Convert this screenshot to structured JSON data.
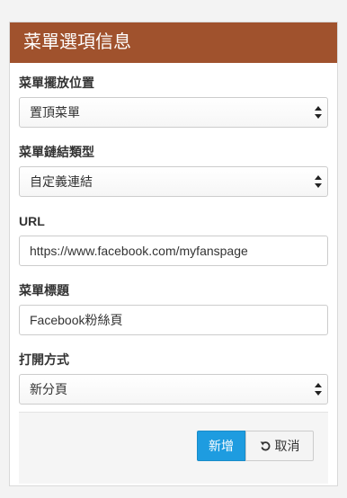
{
  "panel": {
    "title": "菜單選項信息"
  },
  "fields": {
    "position": {
      "label": "菜單擺放位置",
      "value": "置頂菜單"
    },
    "link_type": {
      "label": "菜單鏈結類型",
      "value": "自定義連結"
    },
    "url": {
      "label": "URL",
      "value": "https://www.facebook.com/myfanspage"
    },
    "menu_title": {
      "label": "菜單標題",
      "value": "Facebook粉絲頁"
    },
    "open_mode": {
      "label": "打開方式",
      "value": "新分頁"
    }
  },
  "buttons": {
    "add_label": "新增",
    "cancel_label": "取消",
    "cancel_icon": "undo-icon"
  },
  "colors": {
    "header_bg": "#a0522d",
    "primary_button": "#1e9ce0"
  }
}
